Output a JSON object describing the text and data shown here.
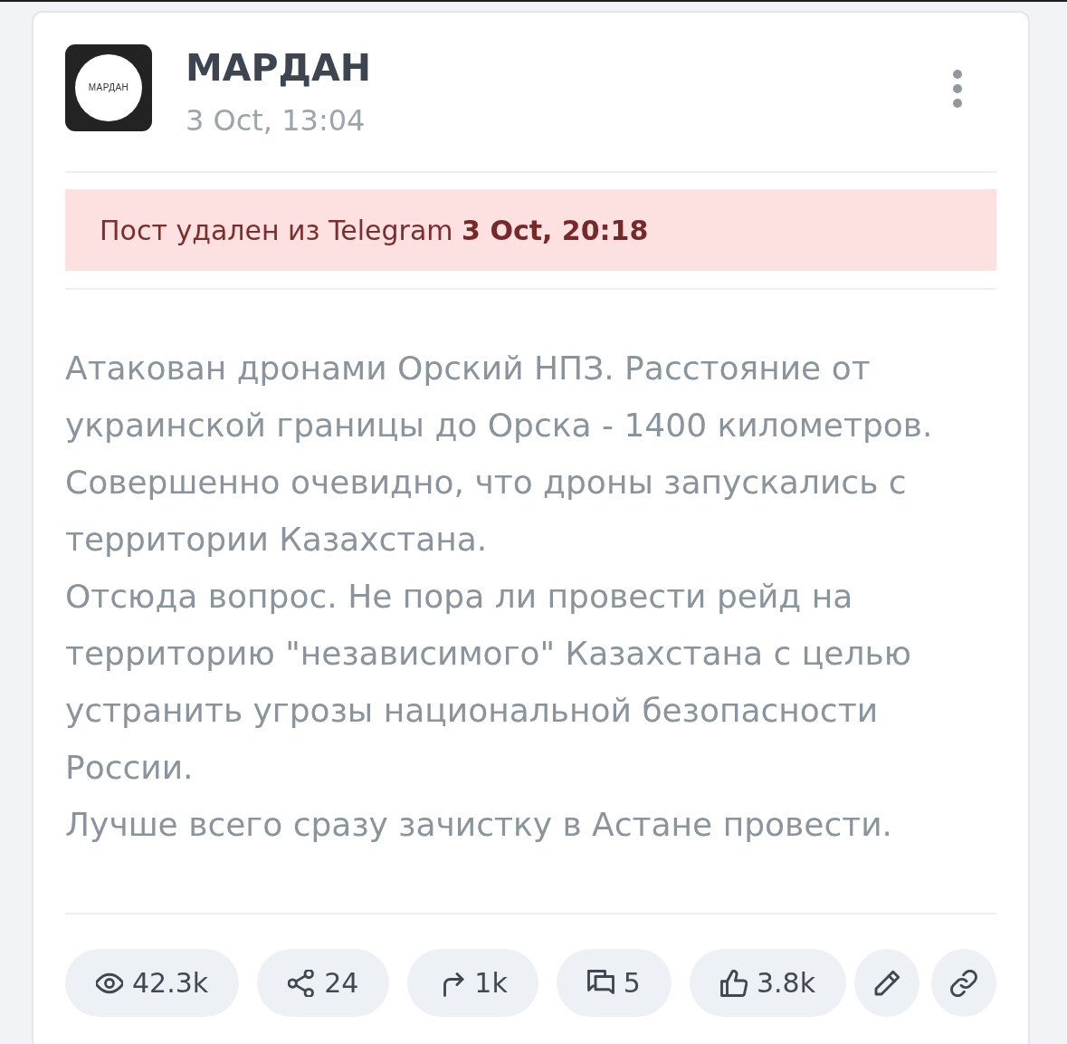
{
  "channel": {
    "logo_text": "МАРДАН",
    "name": "МАРДАН",
    "posted": "3 Oct, 13:04"
  },
  "notice": {
    "text": "Пост удален из Telegram **3 Oct, 20:18**"
  },
  "message": {
    "paragraphs": [
      "Атакован дронами Орский НПЗ. Расстояние от украинской границы до Орска - 1400 километров. Совершенно очевидно, что дроны запускались с территории Казахстана.",
      "Отсюда вопрос. Не пора ли провести рейд на территорию \"независимого\" Казахстана с целью устранить угрозы национальной безопасности России.",
      "Лучше всего сразу зачистку в Астане провести."
    ]
  },
  "stats": [
    {
      "kind": "views",
      "value": "42.3k"
    },
    {
      "kind": "shares",
      "value": "24"
    },
    {
      "kind": "forwards",
      "value": "1k"
    },
    {
      "kind": "comments",
      "value": "5"
    },
    {
      "kind": "reactions",
      "value": "3.8k"
    }
  ],
  "actions": [
    {
      "kind": "edit"
    },
    {
      "kind": "link"
    }
  ]
}
